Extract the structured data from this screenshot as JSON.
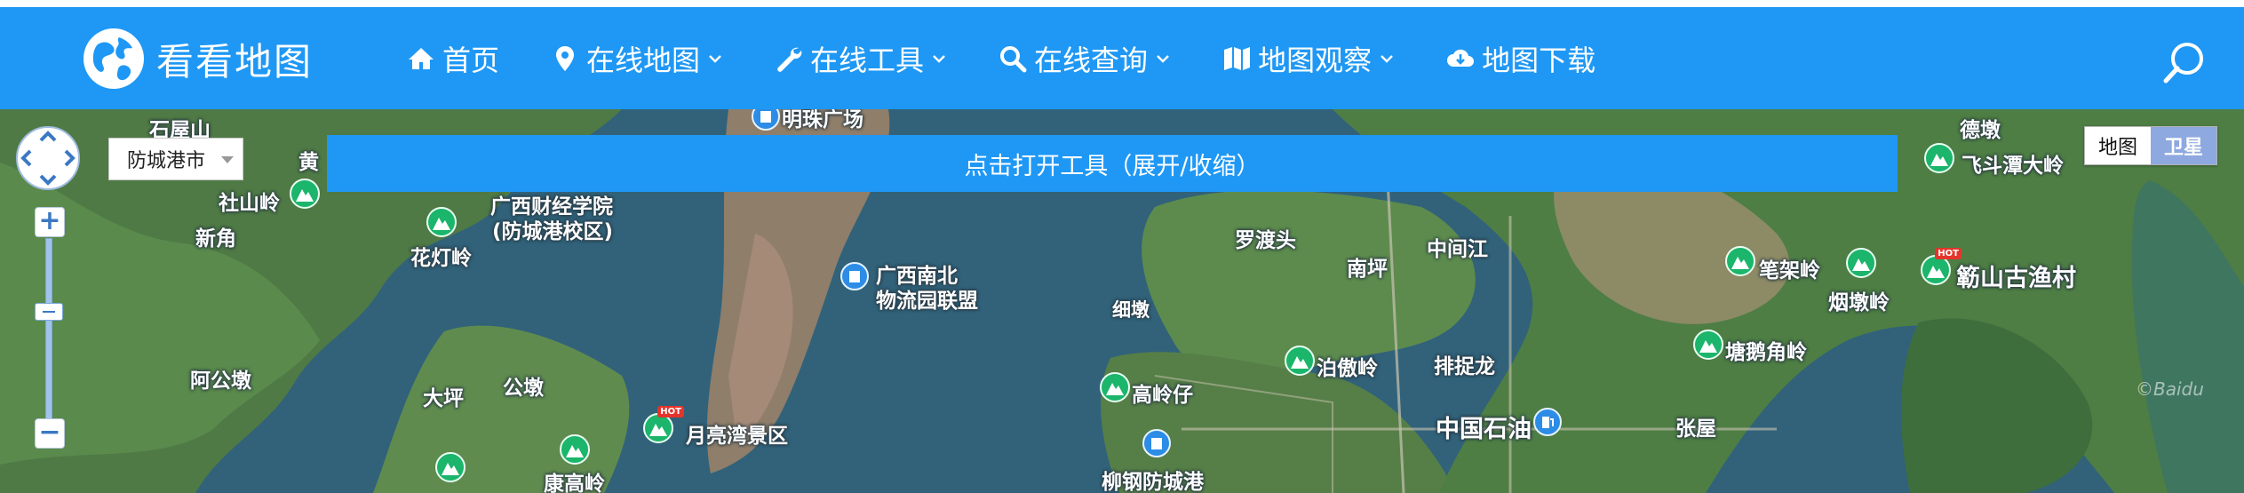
{
  "header": {
    "logo_text": "看看地图",
    "nav": [
      {
        "label": "首页",
        "icon": "home-icon",
        "has_dropdown": false
      },
      {
        "label": "在线地图",
        "icon": "map-marker-icon",
        "has_dropdown": true
      },
      {
        "label": "在线工具",
        "icon": "wrench-icon",
        "has_dropdown": true
      },
      {
        "label": "在线查询",
        "icon": "search-icon",
        "has_dropdown": true
      },
      {
        "label": "地图观察",
        "icon": "folded-map-icon",
        "has_dropdown": true
      },
      {
        "label": "地图下载",
        "icon": "cloud-download-icon",
        "has_dropdown": false
      }
    ],
    "search_icon": "search-icon"
  },
  "map": {
    "city_select": {
      "value": "防城港市"
    },
    "tool_toggle_label": "点击打开工具（展开/收缩）",
    "map_type": {
      "map_label": "地图",
      "satellite_label": "卫星",
      "selected": "卫星"
    },
    "watermark": "©Baidu",
    "labels": [
      "石屋山",
      "黄",
      "社山岭",
      "新角",
      "花灯岭",
      "阿公墩",
      "大坪",
      "公墩",
      "康高岭",
      "广西财经学院",
      "(防城港校区)",
      "明珠广场",
      "广西南北",
      "物流园联盟",
      "细墩",
      "月亮湾景区",
      "高岭仔",
      "泊傲岭",
      "罗渡头",
      "南坪",
      "中间江",
      "排捉龙",
      "柳钢防城港",
      "中国石油",
      "张屋",
      "笔架岭",
      "烟墩岭",
      "塘鹅角岭",
      "簕山古渔村",
      "飞斗潭大岭",
      "德墩"
    ],
    "colors": {
      "header_bg": "#1f98f5",
      "poi_green": "#1bb56b",
      "poi_blue": "#2c8ce6",
      "hot_red": "#e5342b"
    }
  }
}
